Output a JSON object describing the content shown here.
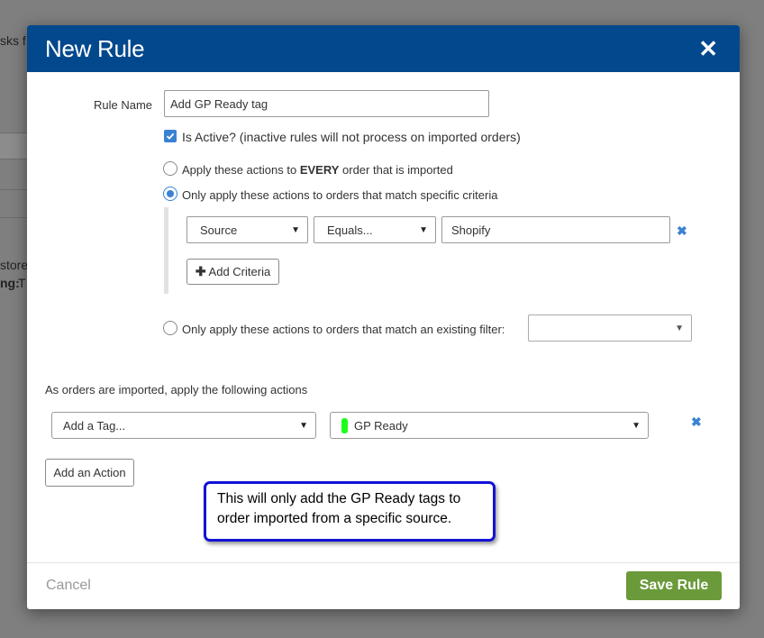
{
  "background": {
    "frag_top": "sks f",
    "frag_store": "store",
    "frag_ng": "ng:",
    "frag_t": "T"
  },
  "modal": {
    "title": "New Rule",
    "close_icon": "close-icon"
  },
  "form": {
    "rule_name_label": "Rule Name",
    "rule_name_value": "Add GP Ready tag",
    "is_active_label": "Is Active? (inactive rules will not process on imported orders)",
    "is_active_checked": true,
    "radio_every_prefix": "Apply these actions to ",
    "radio_every_bold": "EVERY",
    "radio_every_suffix": " order that is imported",
    "radio_specific_label": "Only apply these actions to orders that match specific criteria",
    "radio_filter_label": "Only apply these actions to orders that match an existing filter:",
    "selected_radio": "specific"
  },
  "criteria": {
    "field_value": "Source",
    "operator_value": "Equals...",
    "match_value": "Shopify",
    "add_criteria_label": "Add Criteria"
  },
  "filter_select": {
    "value": ""
  },
  "actions": {
    "heading": "As orders are imported, apply the following actions",
    "action_type_value": "Add a Tag...",
    "tag_value": "GP Ready",
    "tag_color": "#1aff1a",
    "add_action_label": "Add an Action"
  },
  "callout": {
    "text": "This will only add the GP Ready tags to order imported from a specific source."
  },
  "footer": {
    "cancel_label": "Cancel",
    "save_label": "Save Rule"
  },
  "colors": {
    "header": "#02488c",
    "accent": "#3a82d3",
    "save": "#6a9a3a",
    "callout_border": "#1313d6"
  }
}
